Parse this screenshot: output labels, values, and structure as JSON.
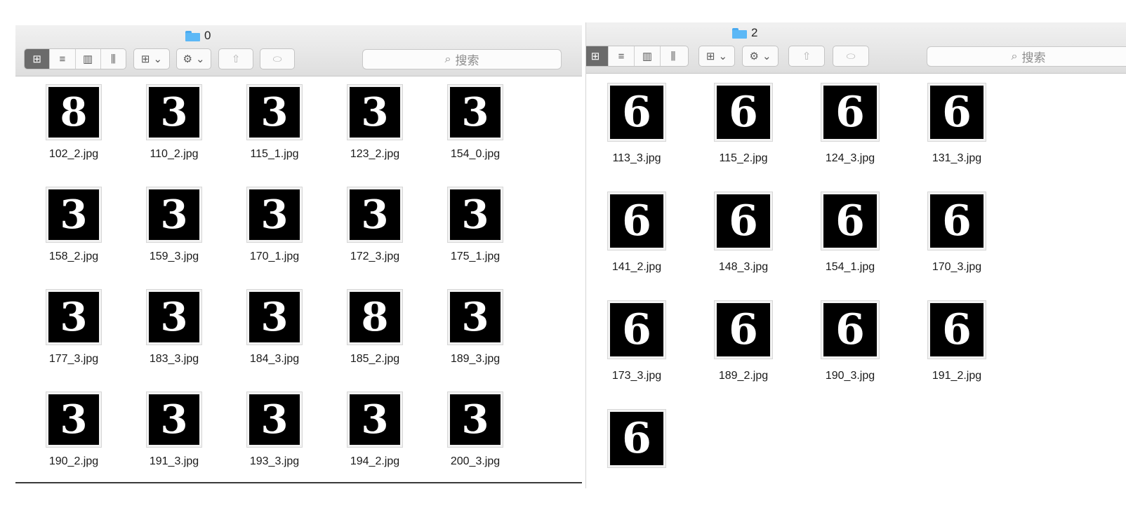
{
  "left_window": {
    "title": "0",
    "search_placeholder": "搜索",
    "files": [
      {
        "name": "102_2.jpg",
        "digit": "8"
      },
      {
        "name": "110_2.jpg",
        "digit": "3"
      },
      {
        "name": "115_1.jpg",
        "digit": "3"
      },
      {
        "name": "123_2.jpg",
        "digit": "3"
      },
      {
        "name": "154_0.jpg",
        "digit": "3"
      },
      {
        "name": "158_2.jpg",
        "digit": "3"
      },
      {
        "name": "159_3.jpg",
        "digit": "3"
      },
      {
        "name": "170_1.jpg",
        "digit": "3"
      },
      {
        "name": "172_3.jpg",
        "digit": "3"
      },
      {
        "name": "175_1.jpg",
        "digit": "3"
      },
      {
        "name": "177_3.jpg",
        "digit": "3"
      },
      {
        "name": "183_3.jpg",
        "digit": "3"
      },
      {
        "name": "184_3.jpg",
        "digit": "3"
      },
      {
        "name": "185_2.jpg",
        "digit": "8"
      },
      {
        "name": "189_3.jpg",
        "digit": "3"
      },
      {
        "name": "190_2.jpg",
        "digit": "3"
      },
      {
        "name": "191_3.jpg",
        "digit": "3"
      },
      {
        "name": "193_3.jpg",
        "digit": "3"
      },
      {
        "name": "194_2.jpg",
        "digit": "3"
      },
      {
        "name": "200_3.jpg",
        "digit": "3"
      }
    ]
  },
  "right_window": {
    "title": "2",
    "search_placeholder": "搜索",
    "files": [
      {
        "name": "113_3.jpg",
        "digit": "6"
      },
      {
        "name": "115_2.jpg",
        "digit": "6"
      },
      {
        "name": "124_3.jpg",
        "digit": "6"
      },
      {
        "name": "131_3.jpg",
        "digit": "6"
      },
      {
        "name": "141_2.jpg",
        "digit": "6"
      },
      {
        "name": "148_3.jpg",
        "digit": "6"
      },
      {
        "name": "154_1.jpg",
        "digit": "6"
      },
      {
        "name": "170_3.jpg",
        "digit": "6"
      },
      {
        "name": "173_3.jpg",
        "digit": "6"
      },
      {
        "name": "189_2.jpg",
        "digit": "6"
      },
      {
        "name": "190_3.jpg",
        "digit": "6"
      },
      {
        "name": "191_2.jpg",
        "digit": "6"
      },
      {
        "name": "",
        "digit": "6"
      }
    ]
  },
  "toolbar": {
    "icons": [
      "icon-view-icon",
      "list-view-icon",
      "column-view-icon",
      "gallery-view-icon",
      "group-icon",
      "gear-icon",
      "share-icon",
      "tag-icon",
      "search-icon"
    ]
  }
}
